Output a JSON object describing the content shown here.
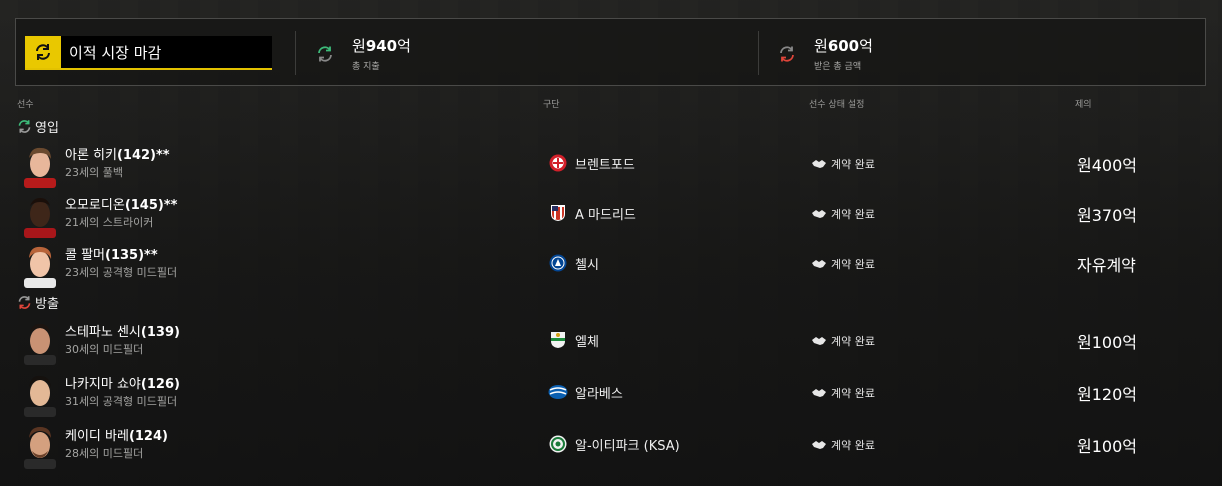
{
  "summary": {
    "deadline_label": "이적 시장 마감",
    "spent": {
      "currency": "원",
      "amount": "940",
      "unit": "억",
      "label": "총 지출"
    },
    "received": {
      "currency": "원",
      "amount": "600",
      "unit": "억",
      "label": "받은 총 금액"
    }
  },
  "columns": {
    "player": "선수",
    "club": "구단",
    "status": "선수 상태 설정",
    "offer": "제의"
  },
  "colors": {
    "accent": "#e9c800",
    "incoming": "#3dbb7a",
    "outgoing": "#e0453a"
  },
  "sections": {
    "incoming_label": "영입",
    "outgoing_label": "방출"
  },
  "incoming": [
    {
      "name": "아론 히키",
      "rating": "(142)**",
      "desc": "23세의 풀백",
      "club": "브렌트포드",
      "crest": "brentford-crest",
      "status": "계약 완료",
      "offer": "원400억"
    },
    {
      "name": "오모로디온",
      "rating": "(145)**",
      "desc": "21세의 스트라이커",
      "club": "A 마드리드",
      "crest": "atletico-crest",
      "status": "계약 완료",
      "offer": "원370억"
    },
    {
      "name": "콜 팔머",
      "rating": "(135)**",
      "desc": "23세의 공격형 미드필더",
      "club": "첼시",
      "crest": "chelsea-crest",
      "status": "계약 완료",
      "offer": "자유계약"
    }
  ],
  "outgoing": [
    {
      "name": "스테파노 센시",
      "rating": "(139)",
      "desc": "30세의 미드필더",
      "club": "엘체",
      "crest": "elche-crest",
      "status": "계약 완료",
      "offer": "원100억"
    },
    {
      "name": "나카지마 쇼야",
      "rating": "(126)",
      "desc": "31세의 공격형 미드필더",
      "club": "알라베스",
      "crest": "alaves-crest",
      "status": "계약 완료",
      "offer": "원120억"
    },
    {
      "name": "케이디 바레",
      "rating": "(124)",
      "desc": "28세의 미드필더",
      "club": "알-이티파크 (KSA)",
      "crest": "al-ettifaq-crest",
      "status": "계약 완료",
      "offer": "원100억"
    }
  ]
}
